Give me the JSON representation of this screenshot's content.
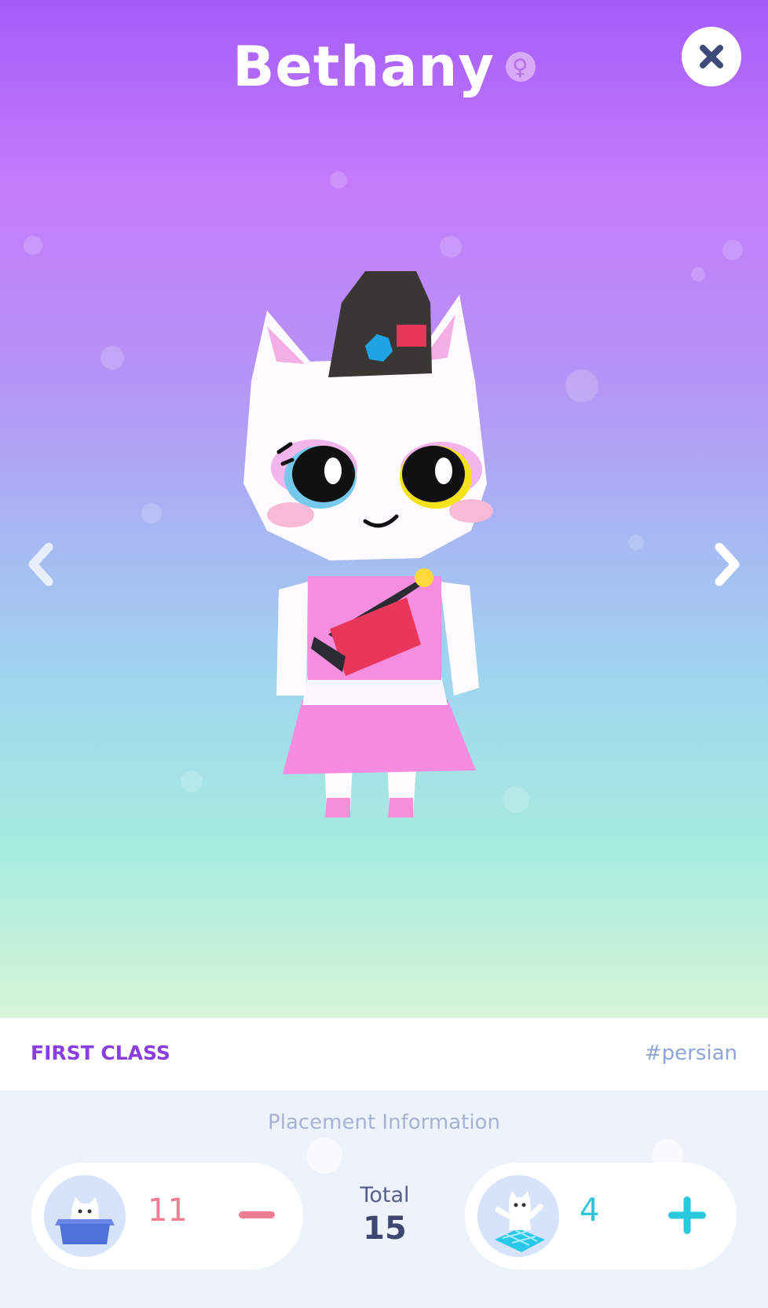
{
  "header": {
    "title": "Bethany",
    "gender_icon": "female-icon",
    "gender_symbol": "♀",
    "close_icon": "close-icon"
  },
  "colors": {
    "gradient_top": "#a45cf8",
    "gradient_bottom": "#d6f4d6",
    "class_color": "#8a3ee0",
    "minus_color": "#f07d94",
    "plus_color": "#29c8dd"
  },
  "navigation": {
    "prev_icon": "chevron-left-icon",
    "next_icon": "chevron-right-icon"
  },
  "info": {
    "class_label": "FIRST CLASS",
    "tag": "#persian"
  },
  "placement": {
    "title": "Placement Information",
    "stored": {
      "count": "11",
      "icon": "cat-in-box-icon",
      "action_icon": "minus-icon"
    },
    "placed": {
      "count": "4",
      "icon": "cat-on-tile-icon",
      "action_icon": "plus-icon"
    },
    "total_label": "Total",
    "total_value": "15"
  }
}
